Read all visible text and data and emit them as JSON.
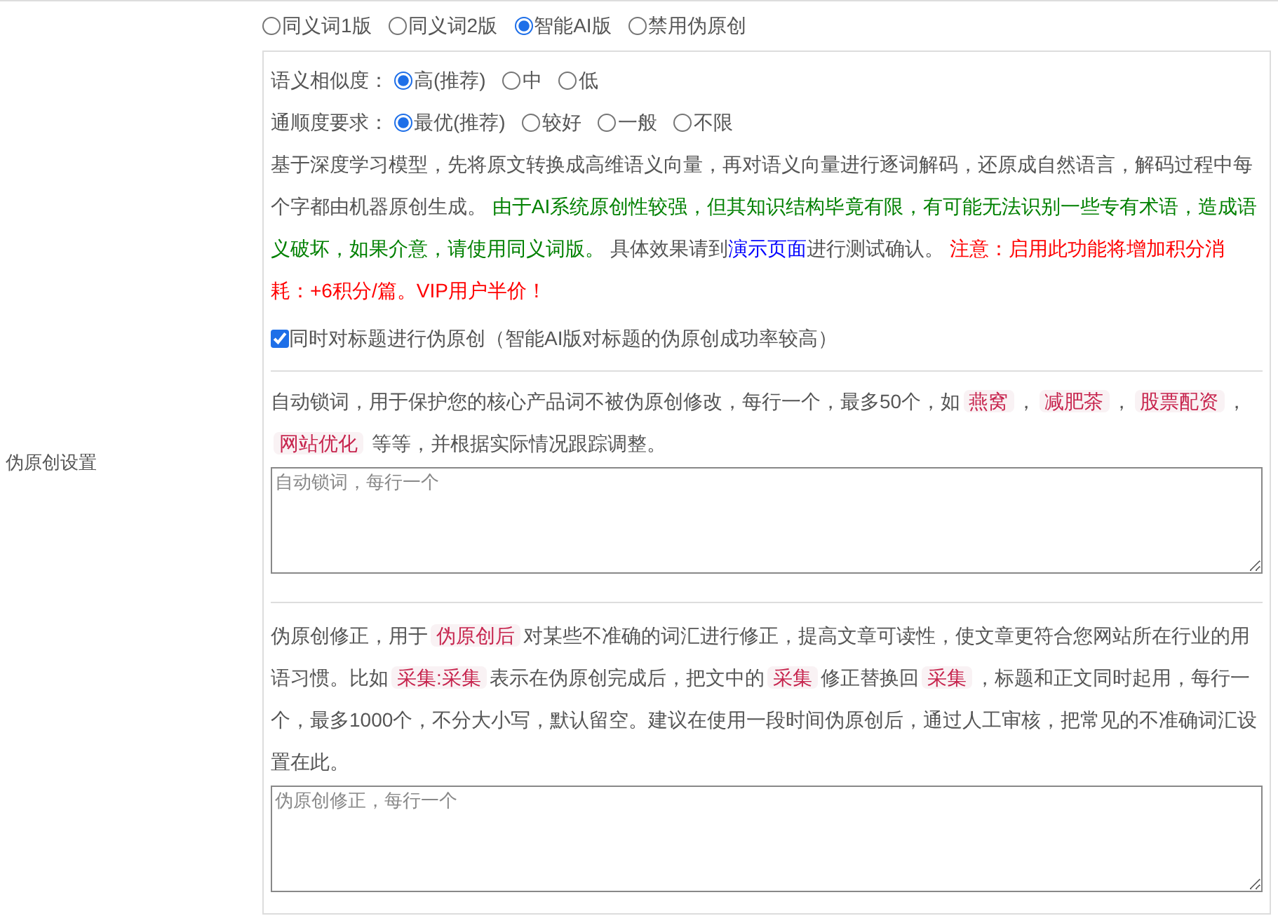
{
  "section_label": "伪原创设置",
  "modes": [
    {
      "label": "同义词1版",
      "selected": false
    },
    {
      "label": "同义词2版",
      "selected": false
    },
    {
      "label": "智能AI版",
      "selected": true
    },
    {
      "label": "禁用伪原创",
      "selected": false
    }
  ],
  "similarity": {
    "label": "语义相似度：",
    "options": [
      {
        "label": "高(推荐)",
        "selected": true
      },
      {
        "label": "中",
        "selected": false
      },
      {
        "label": "低",
        "selected": false
      }
    ]
  },
  "fluency": {
    "label": "通顺度要求：",
    "options": [
      {
        "label": "最优(推荐)",
        "selected": true
      },
      {
        "label": "较好",
        "selected": false
      },
      {
        "label": "一般",
        "selected": false
      },
      {
        "label": "不限",
        "selected": false
      }
    ]
  },
  "description": [
    {
      "kind": "plain",
      "text": "基于深度学习模型，先将原文转换成高维语义向量，再对语义向量进行逐词解码，还原成自然语言，解码过程中每个字都由机器原创生成。 "
    },
    {
      "kind": "success",
      "text": "由于AI系统原创性较强，但其知识结构毕竟有限，有可能无法识别一些专有术语，造成语义破坏，如果介意，请使用同义词版。"
    },
    {
      "kind": "plain",
      "text": " 具体效果请到"
    },
    {
      "kind": "link",
      "text": "演示页面"
    },
    {
      "kind": "plain",
      "text": "进行测试确认。 "
    },
    {
      "kind": "warning",
      "text": "注意：启用此功能将增加积分消耗：+6积分/篇。VIP用户半价！"
    }
  ],
  "title_option": {
    "label": "同时对标题进行伪原创（智能AI版对标题的伪原创成功率较高）",
    "checked": true
  },
  "lock_words": {
    "segments": [
      {
        "kind": "plain",
        "text": "自动锁词，用于保护您的核心产品词不被伪原创修改，每行一个，最多50个，如"
      },
      {
        "kind": "code",
        "text": "燕窝"
      },
      {
        "kind": "plain",
        "text": "，"
      },
      {
        "kind": "code",
        "text": "减肥茶"
      },
      {
        "kind": "plain",
        "text": "，"
      },
      {
        "kind": "code",
        "text": "股票配资"
      },
      {
        "kind": "plain",
        "text": "，"
      },
      {
        "kind": "code",
        "text": "网站优化"
      },
      {
        "kind": "plain",
        "text": " 等等，并根据实际情况跟踪调整。"
      }
    ],
    "placeholder": "自动锁词，每行一个"
  },
  "correction": {
    "segments": [
      {
        "kind": "plain",
        "text": "伪原创修正，用于"
      },
      {
        "kind": "code",
        "text": "伪原创后"
      },
      {
        "kind": "plain",
        "text": "对某些不准确的词汇进行修正，提高文章可读性，使文章更符合您网站所在行业的用语习惯。比如"
      },
      {
        "kind": "code",
        "text": "采集:采集"
      },
      {
        "kind": "plain",
        "text": "表示在伪原创完成后，把文中的"
      },
      {
        "kind": "code",
        "text": "采集"
      },
      {
        "kind": "plain",
        "text": "修正替换回"
      },
      {
        "kind": "code",
        "text": "采集"
      },
      {
        "kind": "plain",
        "text": "，标题和正文同时起用，每行一个，最多1000个，不分大小写，默认留空。建议在使用一段时间伪原创后，通过人工审核，把常见的不准确词汇设置在此。"
      }
    ],
    "placeholder": "伪原创修正，每行一个"
  }
}
